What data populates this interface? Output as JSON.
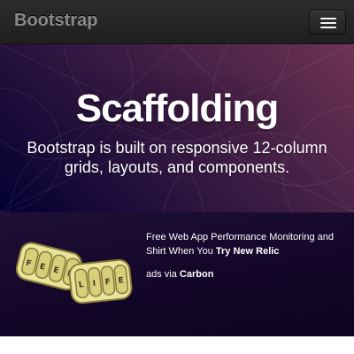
{
  "navbar": {
    "brand": "Bootstrap",
    "menu_icon": "hamburger-icon"
  },
  "hero": {
    "title": "Scaffolding",
    "lead": "Bootstrap is built on responsive 12-column grids, layouts, and components."
  },
  "ad": {
    "image_alt": "Feed Life",
    "text": "Free Web App Performance Monitoring and Shirt When You ",
    "cta": "Try New Relic",
    "via_prefix": "ads via ",
    "via_name": "Carbon"
  },
  "colors": {
    "navbar_bg": "#222222",
    "hero_from": "#020031",
    "hero_to": "#6d3353",
    "ad_bg": "#1a0c30"
  }
}
